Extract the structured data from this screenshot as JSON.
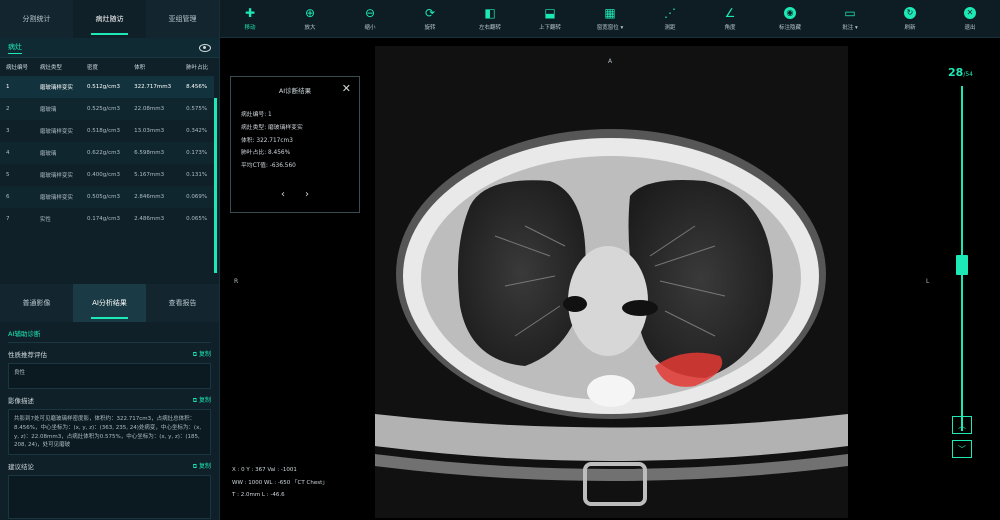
{
  "left": {
    "tabs": [
      "分割统计",
      "病灶随访",
      "亚组管理"
    ],
    "sub_tab": "病灶",
    "table": {
      "headers": [
        "病灶编号",
        "病灶类型",
        "密度",
        "体积",
        "肺叶占比"
      ],
      "rows": [
        [
          "1",
          "磨玻璃样变实",
          "0.512g/cm3",
          "322.717mm3",
          "8.456%"
        ],
        [
          "2",
          "磨玻璃",
          "0.525g/cm3",
          "22.08mm3",
          "0.575%"
        ],
        [
          "3",
          "磨玻璃样变实",
          "0.518g/cm3",
          "13.03mm3",
          "0.342%"
        ],
        [
          "4",
          "磨玻璃",
          "0.622g/cm3",
          "6.598mm3",
          "0.173%"
        ],
        [
          "5",
          "磨玻璃样变实",
          "0.400g/cm3",
          "5.167mm3",
          "0.131%"
        ],
        [
          "6",
          "磨玻璃样变实",
          "0.505g/cm3",
          "2.846mm3",
          "0.069%"
        ],
        [
          "7",
          "实性",
          "0.174g/cm3",
          "2.486mm3",
          "0.065%"
        ]
      ]
    },
    "tabs2": [
      "普通影像",
      "AI分析结果",
      "查看报告"
    ],
    "ai": {
      "heading": "AI辅助诊断",
      "field1_label": "性质推荐评估",
      "field1_value": "良性",
      "field2_label": "影像描述",
      "field2_value": "共影到7处可见磨玻璃样密度影，体积约：322.717cm3，占病灶总体积：8.456%，中心坐标为：(x, y, z)：(363, 235, 24)处病变，中心坐标为：(x, y, z)：22.08mm3，占病灶体积为0.575%，中心坐标为：(x, y, z)：(185, 208, 24)，处可见磨玻",
      "field3_label": "建议结论",
      "field3_value": "",
      "copy_label": "复制"
    }
  },
  "toolbar": [
    {
      "label": "移动",
      "icon": "move-icon"
    },
    {
      "label": "放大",
      "icon": "zoom-in-icon"
    },
    {
      "label": "缩小",
      "icon": "zoom-out-icon"
    },
    {
      "label": "旋转",
      "icon": "rotate-icon"
    },
    {
      "label": "左右翻转",
      "icon": "flip-horizontal-icon"
    },
    {
      "label": "上下翻转",
      "icon": "flip-vertical-icon"
    },
    {
      "label": "窗宽窗位 ▾",
      "icon": "window-level-icon"
    },
    {
      "label": "测距",
      "icon": "measure-icon"
    },
    {
      "label": "角度",
      "icon": "angle-icon"
    },
    {
      "label": "标注隐藏",
      "icon": "eye-icon"
    },
    {
      "label": "批注 ▾",
      "icon": "comment-icon"
    },
    {
      "label": "刷新",
      "icon": "refresh-icon"
    },
    {
      "label": "退出",
      "icon": "exit-icon"
    }
  ],
  "viewer": {
    "orient_top": "A",
    "orient_left": "R",
    "orient_right": "L",
    "ai_panel": {
      "title": "AI诊断结果",
      "rows": [
        "病灶编号:  1",
        "病灶类型:  磨玻璃样变实",
        "体积:  322.717cm3",
        "肺叶占比:  8.456%",
        "平均CT值:  -636.560"
      ]
    },
    "info": [
      "X : 0    Y : 367    Val : -1001",
      "WW : 1000    WL : -650  「CT Chest」",
      "T : 2.0mm    L : -46.6"
    ]
  },
  "slice": {
    "current": "28",
    "total": "/54",
    "fraction": 0.52
  }
}
